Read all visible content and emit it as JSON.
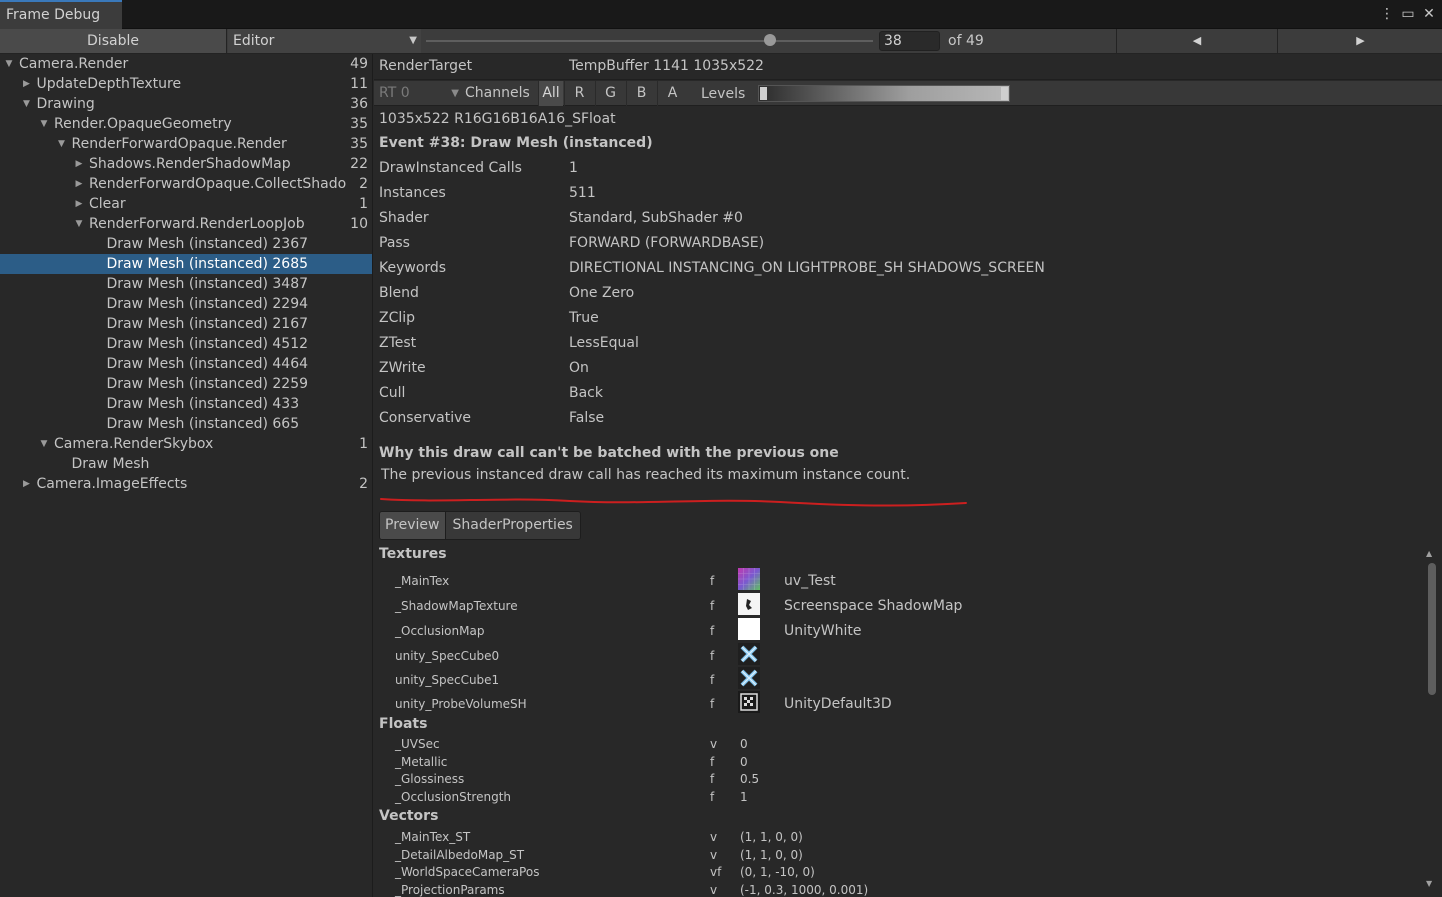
{
  "window": {
    "title": "Frame Debug",
    "icons": [
      "more-options-icon",
      "maximize-icon",
      "close-icon"
    ]
  },
  "toolbar": {
    "disable_label": "Disable",
    "target_value": "Editor",
    "frame_value": "38",
    "frame_total_label": "of 49",
    "prev_icon": "previous-arrow-icon",
    "next_icon": "next-arrow-icon",
    "slider_fraction": 0.77
  },
  "tree": {
    "items": [
      {
        "label": "Camera.Render",
        "count": "49",
        "fold": "expanded",
        "depth": 0
      },
      {
        "label": "UpdateDepthTexture",
        "count": "11",
        "fold": "collapsed",
        "depth": 1
      },
      {
        "label": "Drawing",
        "count": "36",
        "fold": "expanded",
        "depth": 1
      },
      {
        "label": "Render.OpaqueGeometry",
        "count": "35",
        "fold": "expanded",
        "depth": 2
      },
      {
        "label": "RenderForwardOpaque.Render",
        "count": "35",
        "fold": "expanded",
        "depth": 3
      },
      {
        "label": "Shadows.RenderShadowMap",
        "count": "22",
        "fold": "collapsed",
        "depth": 4
      },
      {
        "label": "RenderForwardOpaque.CollectShado",
        "count": "2",
        "fold": "collapsed",
        "depth": 4
      },
      {
        "label": "Clear",
        "count": "1",
        "fold": "collapsed",
        "depth": 4
      },
      {
        "label": "RenderForward.RenderLoopJob",
        "count": "10",
        "fold": "expanded",
        "depth": 4
      },
      {
        "label": "Draw Mesh (instanced) 2367",
        "count": "",
        "fold": "none",
        "depth": 5
      },
      {
        "label": "Draw Mesh (instanced) 2685",
        "count": "",
        "fold": "none",
        "depth": 5,
        "selected": true
      },
      {
        "label": "Draw Mesh (instanced) 3487",
        "count": "",
        "fold": "none",
        "depth": 5
      },
      {
        "label": "Draw Mesh (instanced) 2294",
        "count": "",
        "fold": "none",
        "depth": 5
      },
      {
        "label": "Draw Mesh (instanced) 2167",
        "count": "",
        "fold": "none",
        "depth": 5
      },
      {
        "label": "Draw Mesh (instanced) 4512",
        "count": "",
        "fold": "none",
        "depth": 5
      },
      {
        "label": "Draw Mesh (instanced) 4464",
        "count": "",
        "fold": "none",
        "depth": 5
      },
      {
        "label": "Draw Mesh (instanced) 2259",
        "count": "",
        "fold": "none",
        "depth": 5
      },
      {
        "label": "Draw Mesh (instanced) 433",
        "count": "",
        "fold": "none",
        "depth": 5
      },
      {
        "label": "Draw Mesh (instanced) 665",
        "count": "",
        "fold": "none",
        "depth": 5
      },
      {
        "label": "Camera.RenderSkybox",
        "count": "1",
        "fold": "expanded",
        "depth": 2
      },
      {
        "label": "Draw Mesh",
        "count": "",
        "fold": "none",
        "depth": 3
      },
      {
        "label": "Camera.ImageEffects",
        "count": "2",
        "fold": "collapsed",
        "depth": 1
      }
    ]
  },
  "details": {
    "render_target_key": "RenderTarget",
    "render_target_value": "TempBuffer 1141 1035x522",
    "rt_select": "RT 0",
    "channels_label": "Channels",
    "channels": [
      "All",
      "R",
      "G",
      "B",
      "A"
    ],
    "levels_label": "Levels",
    "format_line": "1035x522 R16G16B16A16_SFloat",
    "event_title": "Event #38: Draw Mesh (instanced)",
    "properties": [
      {
        "key": "DrawInstanced Calls",
        "value": "1"
      },
      {
        "key": "Instances",
        "value": "511"
      },
      {
        "key": "Shader",
        "value": "Standard, SubShader #0"
      },
      {
        "key": "Pass",
        "value": "FORWARD (FORWARDBASE)"
      },
      {
        "key": "Keywords",
        "value": "DIRECTIONAL INSTANCING_ON LIGHTPROBE_SH SHADOWS_SCREEN"
      },
      {
        "key": "Blend",
        "value": "One Zero"
      },
      {
        "key": "ZClip",
        "value": "True"
      },
      {
        "key": "ZTest",
        "value": "LessEqual"
      },
      {
        "key": "ZWrite",
        "value": "On"
      },
      {
        "key": "Cull",
        "value": "Back"
      },
      {
        "key": "Conservative",
        "value": "False"
      }
    ],
    "batch_heading": "Why this draw call can't be batched with the previous one",
    "batch_reason": "The previous instanced draw call has reached its maximum instance count.",
    "annotation_color": "#cc1f1f",
    "tabs": [
      "Preview",
      "ShaderProperties"
    ]
  },
  "shader_props": {
    "textures_title": "Textures",
    "textures": [
      {
        "name": "_MainTex",
        "type": "f",
        "value": "uv_Test",
        "thumb": "uv-gradient-thumbnail"
      },
      {
        "name": "_ShadowMapTexture",
        "type": "f",
        "value": "Screenspace ShadowMap",
        "thumb": "shadowmap-thumbnail"
      },
      {
        "name": "_OcclusionMap",
        "type": "f",
        "value": "UnityWhite",
        "thumb": "white-thumbnail"
      },
      {
        "name": "unity_SpecCube0",
        "type": "f",
        "value": "",
        "thumb": "cubemap-thumbnail"
      },
      {
        "name": "unity_SpecCube1",
        "type": "f",
        "value": "",
        "thumb": "cubemap-thumbnail"
      },
      {
        "name": "unity_ProbeVolumeSH",
        "type": "f",
        "value": "UnityDefault3D",
        "thumb": "3d-texture-thumbnail"
      }
    ],
    "floats_title": "Floats",
    "floats": [
      {
        "name": "_UVSec",
        "type": "v",
        "value": "0"
      },
      {
        "name": "_Metallic",
        "type": "f",
        "value": "0"
      },
      {
        "name": "_Glossiness",
        "type": "f",
        "value": "0.5"
      },
      {
        "name": "_OcclusionStrength",
        "type": "f",
        "value": "1"
      }
    ],
    "vectors_title": "Vectors",
    "vectors": [
      {
        "name": "_MainTex_ST",
        "type": "v",
        "value": "(1, 1, 0, 0)"
      },
      {
        "name": "_DetailAlbedoMap_ST",
        "type": "v",
        "value": "(1, 1, 0, 0)"
      },
      {
        "name": "_WorldSpaceCameraPos",
        "type": "vf",
        "value": "(0, 1, -10, 0)"
      },
      {
        "name": "_ProjectionParams",
        "type": "v",
        "value": "(-1, 0.3, 1000, 0.001)"
      }
    ]
  }
}
